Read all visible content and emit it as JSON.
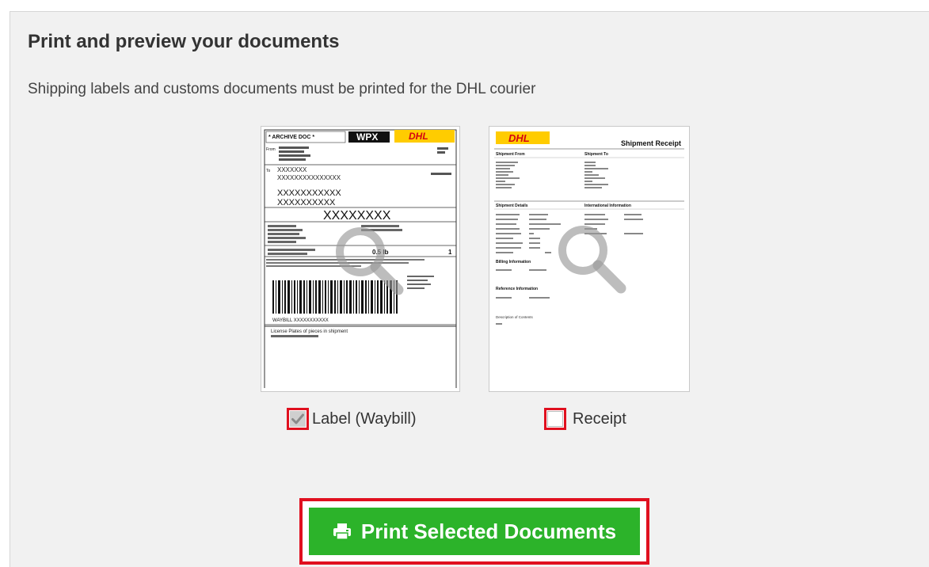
{
  "header": {
    "title": "Print and preview your documents",
    "subtitle": "Shipping labels and customs documents must be printed for the DHL courier"
  },
  "documents": [
    {
      "label": "Label (Waybill)",
      "checked": true,
      "preview": {
        "archive": "* ARCHIVE DOC *",
        "product": "WPX",
        "brand": "DHL",
        "from_label": "From",
        "to_label": "To",
        "name_mask": "XXXXXXX",
        "addr_mask_1": "XXXXXXXXXXXXXXX",
        "addr_mask_2": "XXXXXXXXXXX",
        "addr_mask_3": "XXXXXXXXXX",
        "big_mask": "XXXXXXXX",
        "weight": "0.5 lb",
        "pieces": "1",
        "waybill_line": "WAYBILL XXXXXXXXXXX",
        "footer_line": "License Plates of pieces in shipment"
      }
    },
    {
      "label": "Receipt",
      "checked": false,
      "preview": {
        "brand": "DHL",
        "heading": "Shipment Receipt",
        "col1": "Shipment From",
        "col2": "Shipment To",
        "section1": "Shipment Details",
        "section2": "International Information",
        "section3": "Billing Information",
        "section4": "Reference Information",
        "section5": "Description of Contents"
      }
    }
  ],
  "actions": {
    "print_label": "Print Selected Documents"
  },
  "colors": {
    "accent_red": "#e0101f",
    "button_green": "#2cb32a",
    "dhl_yellow": "#ffcc00",
    "dhl_red": "#d40511"
  }
}
